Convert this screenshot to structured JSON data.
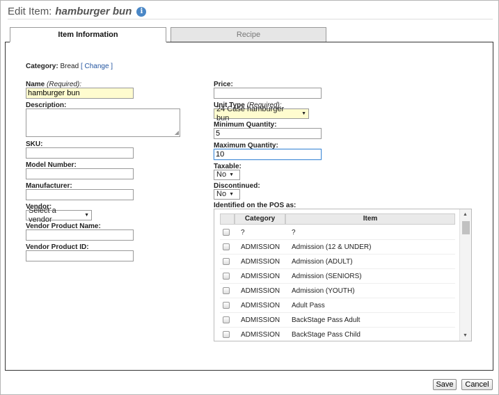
{
  "title": {
    "prefix": "Edit Item:",
    "item_name": "hamburger bun"
  },
  "tabs": [
    {
      "label": "Item Information",
      "active": true
    },
    {
      "label": "Recipe",
      "active": false
    }
  ],
  "category": {
    "label": "Category:",
    "value": "Bread",
    "change_link": "[ Change ]"
  },
  "left_form": {
    "name": {
      "label": "Name",
      "required": "(Required):",
      "value": "hamburger bun"
    },
    "description": {
      "label": "Description:",
      "value": ""
    },
    "sku": {
      "label": "SKU:",
      "value": ""
    },
    "model_number": {
      "label": "Model Number:",
      "value": ""
    },
    "manufacturer": {
      "label": "Manufacturer:",
      "value": ""
    },
    "vendor": {
      "label": "Vendor:",
      "selected": "Select a vendor"
    },
    "vendor_product_name": {
      "label": "Vendor Product Name:",
      "value": ""
    },
    "vendor_product_id": {
      "label": "Vendor Product ID:",
      "value": ""
    }
  },
  "right_form": {
    "price": {
      "label": "Price:",
      "value": ""
    },
    "unit_type": {
      "label": "Unit Type",
      "required": "(Required):",
      "selected": "24 Case hamburger bun"
    },
    "minimum_quantity": {
      "label": "Minimum Quantity:",
      "value": "5"
    },
    "maximum_quantity": {
      "label": "Maximum Quantity:",
      "value": "10"
    },
    "taxable": {
      "label": "Taxable:",
      "selected": "No"
    },
    "discontinued": {
      "label": "Discontinued:",
      "selected": "No"
    },
    "pos_label": "Identified on the POS as:"
  },
  "pos_table": {
    "headers": {
      "category": "Category",
      "item": "Item"
    },
    "rows": [
      {
        "category": "?",
        "item": "?"
      },
      {
        "category": "ADMISSION",
        "item": "Admission (12 & UNDER)"
      },
      {
        "category": "ADMISSION",
        "item": "Admission (ADULT)"
      },
      {
        "category": "ADMISSION",
        "item": "Admission (SENIORS)"
      },
      {
        "category": "ADMISSION",
        "item": "Admission (YOUTH)"
      },
      {
        "category": "ADMISSION",
        "item": "Adult Pass"
      },
      {
        "category": "ADMISSION",
        "item": "BackStage Pass Adult"
      },
      {
        "category": "ADMISSION",
        "item": "BackStage Pass Child"
      }
    ]
  },
  "buttons": {
    "save": "Save",
    "cancel": "Cancel"
  },
  "icons": {
    "info": "info-icon",
    "scroll_up": "arrow-up-icon",
    "scroll_down": "arrow-down-icon",
    "dropdown": "dropdown-arrow-icon"
  }
}
